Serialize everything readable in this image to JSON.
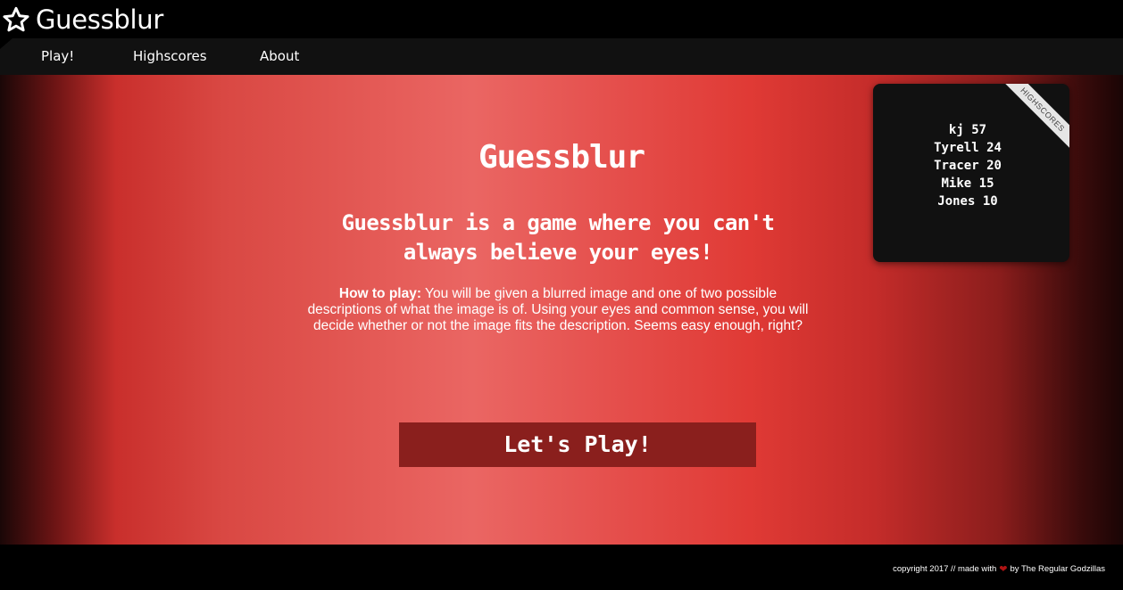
{
  "header": {
    "brand_icon": "star-outline-icon",
    "title": "Guessblur"
  },
  "nav": {
    "items": [
      {
        "label": "Play!"
      },
      {
        "label": "Highscores"
      },
      {
        "label": "About"
      }
    ]
  },
  "hero": {
    "title": "Guessblur",
    "subtitle": "Guessblur is a game where you can't always believe your eyes!",
    "howto_label": "How to play:",
    "howto_text": " You will be given a blurred image and one of two possible descriptions of what the image is of. Using your eyes and common sense, you will decide whether or not the image fits the description. Seems easy enough, right?",
    "play_button": "Let's Play!"
  },
  "highscores": {
    "ribbon": "HIGHSCORES",
    "entries": [
      {
        "name": "kj",
        "score": 57
      },
      {
        "name": "Tyrell",
        "score": 24
      },
      {
        "name": "Tracer",
        "score": 20
      },
      {
        "name": "Mike",
        "score": 15
      },
      {
        "name": "Jones",
        "score": 10
      }
    ]
  },
  "footer": {
    "prefix": "copyright 2017 // made with",
    "heart_icon": "heart-icon",
    "suffix": "by The Regular Godzillas"
  },
  "colors": {
    "hero_accent": "#e45a56",
    "button_bg": "#8a1f1d",
    "panel_bg": "#111111"
  }
}
